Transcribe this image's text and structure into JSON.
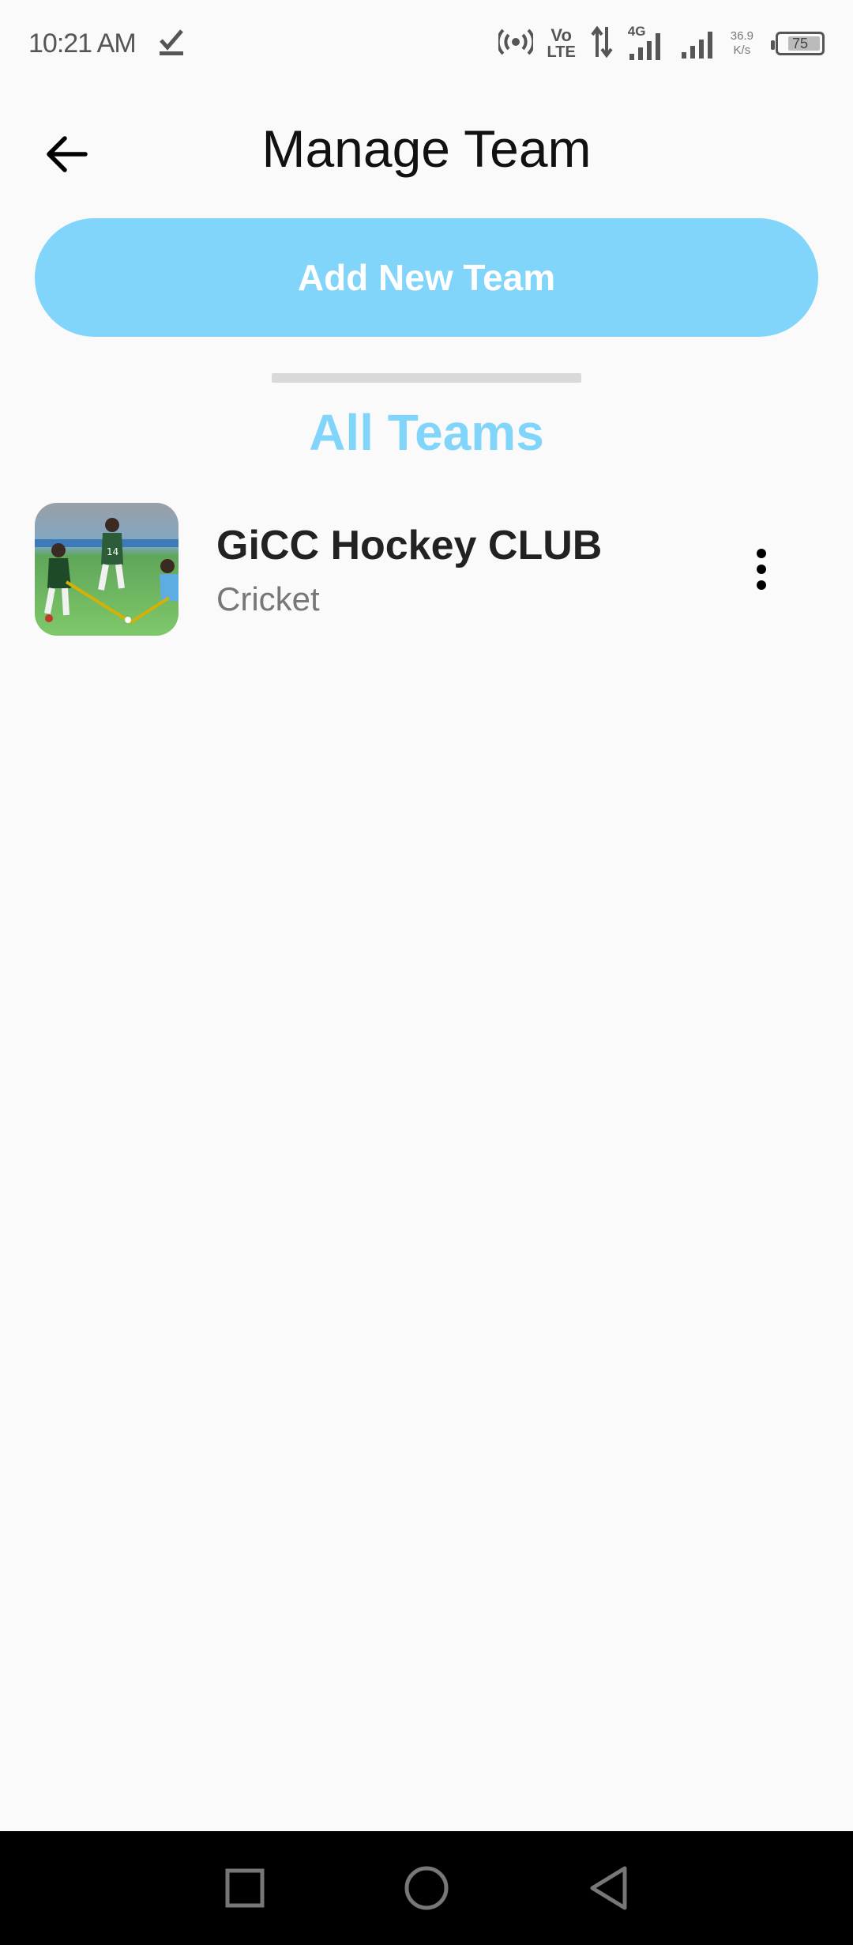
{
  "status_bar": {
    "time": "10:21 AM",
    "volte_top": "Vo",
    "volte_bottom": "LTE",
    "network": "4G",
    "speed_value": "36.9",
    "speed_unit": "K/s",
    "battery": "75"
  },
  "header": {
    "title": "Manage Team"
  },
  "actions": {
    "add_team_label": "Add New Team"
  },
  "section": {
    "title": "All Teams"
  },
  "teams": [
    {
      "name": "GiCC Hockey CLUB",
      "sport": "Cricket"
    }
  ],
  "colors": {
    "accent": "#81d4fa",
    "background": "#fafafa",
    "nav_bar": "#000000"
  }
}
